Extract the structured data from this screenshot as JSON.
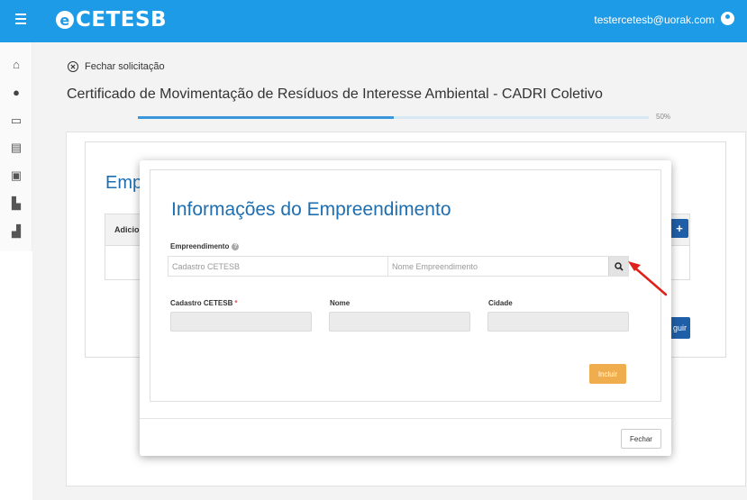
{
  "header": {
    "logo_mark": "e",
    "logo_text": "CETESB",
    "user_email": "testercetesb@uorak.com"
  },
  "sidebar": {
    "items": [
      {
        "icon": "home-icon",
        "glyph": "⌂"
      },
      {
        "icon": "location-pin-icon",
        "glyph": "●"
      },
      {
        "icon": "monitor-icon",
        "glyph": "▭"
      },
      {
        "icon": "archive-icon",
        "glyph": "▤"
      },
      {
        "icon": "briefcase-icon",
        "glyph": "▣"
      },
      {
        "icon": "building-icon",
        "glyph": "▙"
      },
      {
        "icon": "city-icon",
        "glyph": "▟"
      }
    ]
  },
  "page": {
    "close_request": "Fechar solicitação",
    "title": "Certificado de Movimentação de Resíduos de Interesse Ambiental - CADRI Coletivo",
    "progress_value": 0.5,
    "progress_label": "50%"
  },
  "background": {
    "heading": "Emp",
    "table_col": "Adicio",
    "add_symbol": "+",
    "next_label": "guir"
  },
  "modal": {
    "title": "Informações do Empreendimento",
    "empreendimento_label": "Empreendimento",
    "help_glyph": "?",
    "cadastro_placeholder": "Cadastro CETESB",
    "nome_placeholder": "Nome Empreendimento",
    "cadastro_label": "Cadastro CETESB",
    "required_mark": "*",
    "nome_label": "Nome",
    "cidade_label": "Cidade",
    "incluir_label": "Incluir",
    "fechar_label": "Fechar"
  },
  "colors": {
    "topbar": "#1e9be6",
    "primary_dark": "#1f5fa8",
    "warning": "#f0ad4e",
    "annotation_arrow": "#e0201b"
  }
}
